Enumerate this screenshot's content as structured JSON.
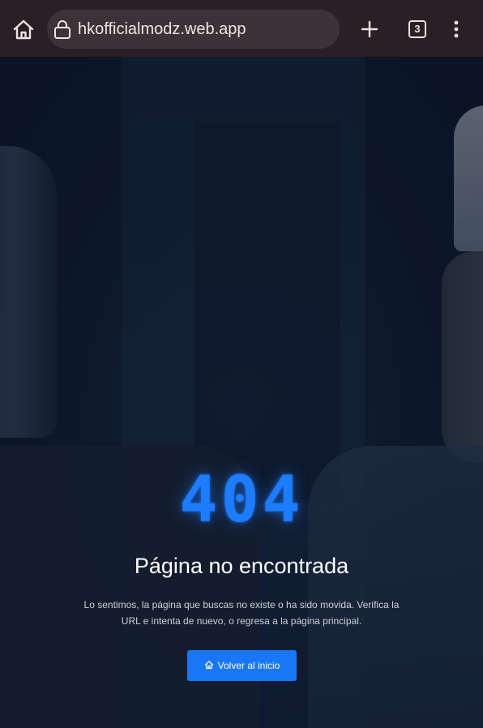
{
  "browser": {
    "url": "hkofficialmodz.web.app",
    "tab_count": "3",
    "icons": {
      "home": "home-icon",
      "lock": "lock-icon",
      "new_tab": "plus-icon",
      "menu": "more-vert-icon"
    }
  },
  "error_page": {
    "code": "404",
    "title": "Página no encontrada",
    "description": "Lo sentimos, la página que buscas no existe o ha sido movida. Verifica la URL e intenta de nuevo, o regresa a la página principal.",
    "button_label": "Volver al inicio",
    "button_icon": "home-icon",
    "accent_color": "#1e7cff",
    "button_color": "#1976f5"
  }
}
